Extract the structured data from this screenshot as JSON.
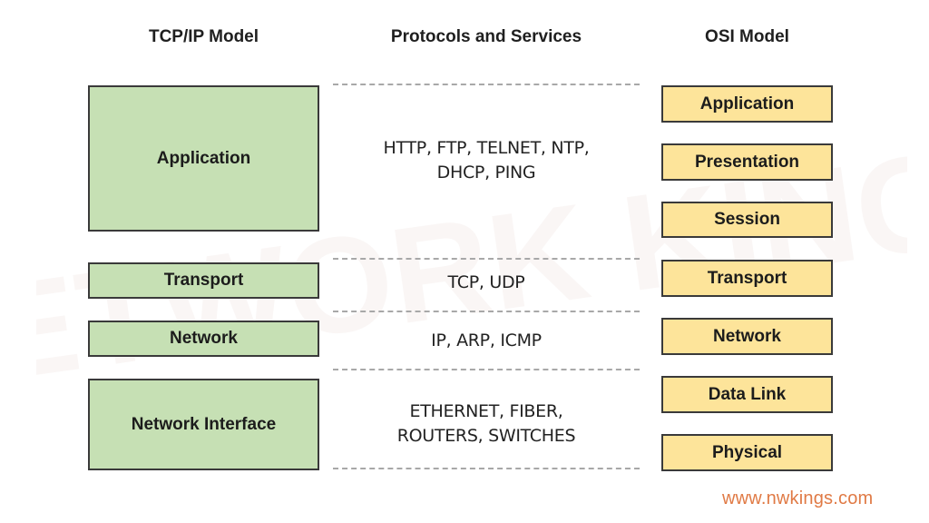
{
  "headers": {
    "tcpip": "TCP/IP Model",
    "protocols": "Protocols and Services",
    "osi": "OSI Model"
  },
  "tcpip_layers": [
    {
      "label": "Application"
    },
    {
      "label": "Transport"
    },
    {
      "label": "Network"
    },
    {
      "label": "Network Interface"
    }
  ],
  "protocols": [
    {
      "line1": "HTTP, FTP, TELNET, NTP,",
      "line2": "DHCP, PING"
    },
    {
      "line1": "TCP, UDP"
    },
    {
      "line1": "IP, ARP, ICMP"
    },
    {
      "line1": "ETHERNET, FIBER,",
      "line2": "ROUTERS, SWITCHES"
    }
  ],
  "osi_layers": [
    {
      "label": "Application"
    },
    {
      "label": "Presentation"
    },
    {
      "label": "Session"
    },
    {
      "label": "Transport"
    },
    {
      "label": "Network"
    },
    {
      "label": "Data Link"
    },
    {
      "label": "Physical"
    }
  ],
  "watermark": "NETWORK KINGS",
  "footer": {
    "website": "www.nwkings.com"
  },
  "colors": {
    "tcpip_fill": "#c6e0b4",
    "osi_fill": "#fde49a",
    "border": "#3a3a3a",
    "dashed_line": "#a8a8a8",
    "website": "#e07a45"
  }
}
